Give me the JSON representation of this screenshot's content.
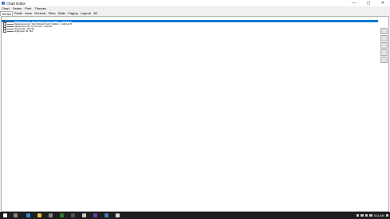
{
  "window": {
    "title": "Chart Editor",
    "buttons": [
      "—",
      "▢",
      "✕"
    ]
  },
  "menu": [
    "Chart",
    "Series",
    "Print",
    "Themes"
  ],
  "tabs": [
    "Series",
    "Panel",
    "Axes",
    "General",
    "Titles",
    "Walls",
    "Paging",
    "Legend",
    "3D"
  ],
  "series_list": [
    {
      "label": "Measurements: Sub-Woofer Field: Caliber - Cabinet A",
      "selected": true
    },
    {
      "label": "Measurements: Sub-Woofer Field: Caliber - Cabinet B",
      "selected": false
    },
    {
      "label": "Measurements: Front Left - Smooth",
      "selected": false
    },
    {
      "label": "Subwoofer: IR TEL",
      "selected": false
    },
    {
      "label": "Highpass: IR TEL",
      "selected": false
    }
  ],
  "side_buttons": [
    "",
    "",
    "",
    "",
    ""
  ],
  "taskbar": {
    "time": "8:11 AM"
  }
}
